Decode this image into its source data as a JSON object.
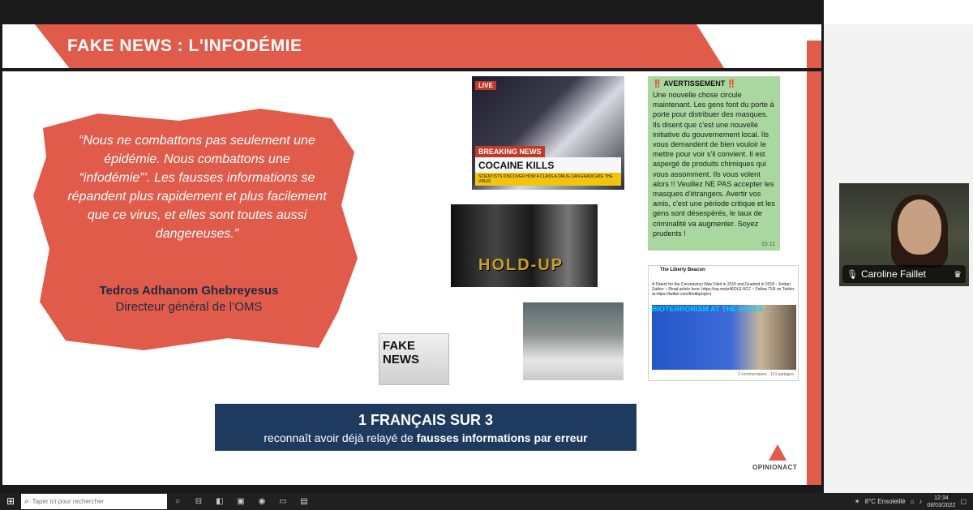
{
  "slide": {
    "title": "FAKE NEWS : L'INFODÉMIE",
    "quote": "“Nous ne combattons pas seulement une épidémie. Nous combattons une “infodémie”’. Les fausses informations se répandent plus rapidement et plus facilement que ce virus, et elles sont toutes aussi dangereuses.”",
    "quote_author": "Tedros Adhanom Ghebreyesus",
    "quote_role": "Directeur général de l’OMS",
    "images": {
      "cocaine": {
        "live": "LIVE",
        "breaking": "BREAKING NEWS",
        "headline": "COCAINE KILLS CORONAVIRUS",
        "subline": "SCIENTISTS DISCOVER HOW A CLASS A DRUG CAN ERADICATE THE VIRUS"
      },
      "warning": {
        "title": "‼️ AVERTISSEMENT ‼️",
        "body": "Une nouvelle chose circule maintenant. Les gens font du porte à porte pour distribuer des masques. Ils disent que c'est une nouvelle initiative du gouvernement local. Ils vous demandent de bien vouloir le mettre pour voir s'il convient. Il est aspergé de produits chimiques qui vous assomment. Ils vous volent alors !! Veuillez NE PAS accepter les masques d'étrangers. Avertir vos amis, c'est une période critique et les gens sont désespérés, le taux de criminalité va augmenter. Soyez prudents !",
        "time": "15:11"
      },
      "holdup": {
        "label": "HOLD-UP"
      },
      "fakenews": {
        "label": "FAKE NEWS"
      },
      "liberty": {
        "page": "The Liberty Beacon",
        "post": "A Patent for the Coronavirus Was Filed in 2015 and Granted in 2018 - Jordan Sather ~ Read article here: https://wp.me/p46OLE-5G7 ~ Follow TLB on Twitter at https://twitter.com/thetlbproject",
        "image_text": "BIOTERRORISM AT THE GATES",
        "footer": "2 commentaires · 113 partages"
      }
    },
    "stat": {
      "headline": "1 FRANÇAIS SUR 3",
      "sub_prefix": "reconnaît avoir déjà relayé de",
      "sub_bold": "fausses informations par erreur"
    },
    "logo": "OPINIONACT"
  },
  "video": {
    "participant": "Caroline Faillet",
    "icons": {
      "mic": "mic-icon",
      "host": "crown-icon"
    }
  },
  "taskbar": {
    "search_placeholder": "Taper ici pour rechercher",
    "weather": "8°C Ensoleillé",
    "time": "12:34",
    "date": "08/03/2022"
  },
  "colors": {
    "accent": "#e15b4b",
    "navy": "#1f3a5f",
    "warning_green": "#a9d79f"
  }
}
